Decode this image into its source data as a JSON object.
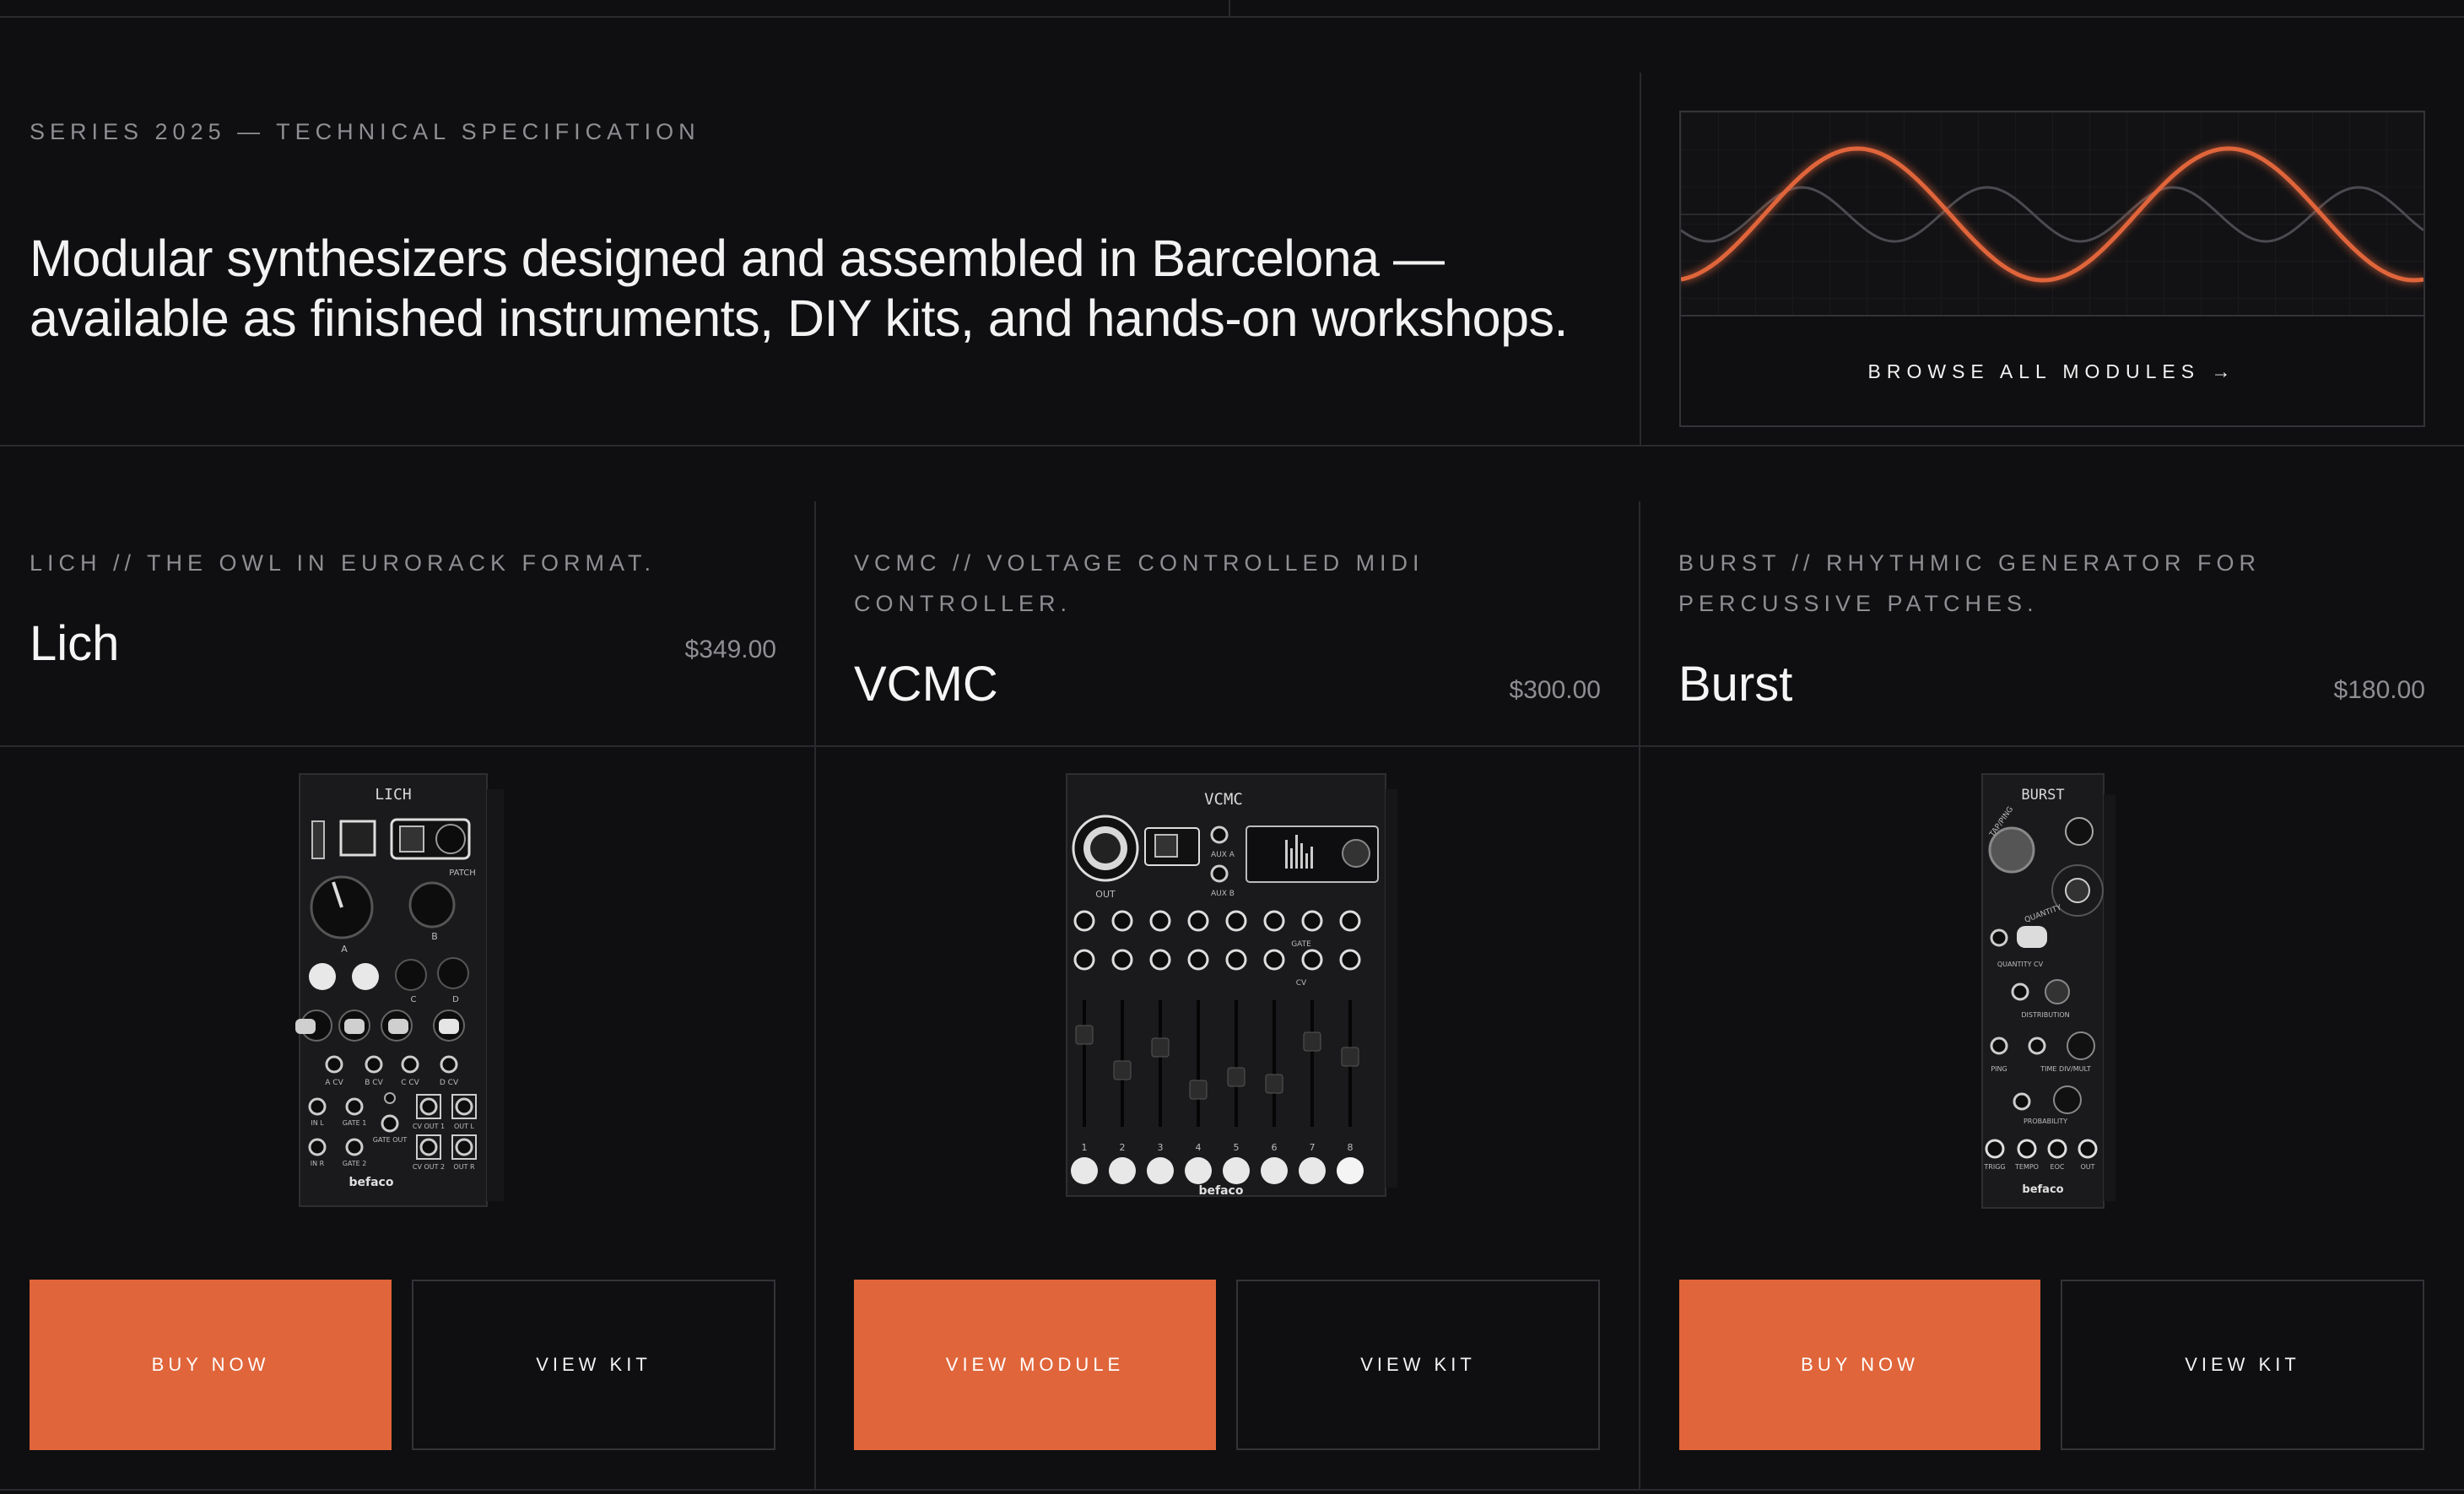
{
  "hero": {
    "eyebrow": "SERIES 2025 — TECHNICAL SPECIFICATION",
    "tagline_line1": "Modular synthesizers designed and assembled in Barcelona —",
    "tagline_line2": "available as finished instruments, DIY kits, and hands-on workshops.",
    "browse_label": "BROWSE ALL MODULES →",
    "accent_color": "#e0653a"
  },
  "products": [
    {
      "subtitle": "LICH // THE OWL IN EURORACK FORMAT.",
      "name": "Lich",
      "price": "$349.00",
      "primary_label": "BUY NOW",
      "secondary_label": "VIEW KIT",
      "panel": {
        "header": "LICH",
        "brand": "befaco",
        "labels": [
          "PATCH",
          "A",
          "B",
          "C",
          "D",
          "A CV",
          "B CV",
          "C CV",
          "D CV",
          "IN L",
          "IN R",
          "GATE 1",
          "GATE 2",
          "GATE OUT",
          "CV OUT 1",
          "CV OUT 2",
          "OUT L",
          "OUT R"
        ]
      }
    },
    {
      "subtitle": "VCMC // VOLTAGE CONTROLLED MIDI CONTROLLER.",
      "name": "VCMC",
      "price": "$300.00",
      "primary_label": "VIEW MODULE",
      "secondary_label": "VIEW KIT",
      "panel": {
        "header": "VCMC",
        "brand": "befaco",
        "labels": [
          "OUT",
          "AUX A",
          "AUX B",
          "GATE",
          "CV",
          "1",
          "2",
          "3",
          "4",
          "5",
          "6",
          "7",
          "8"
        ]
      }
    },
    {
      "subtitle": "BURST // RHYTHMIC GENERATOR FOR PERCUSSIVE PATCHES.",
      "name": "Burst",
      "price": "$180.00",
      "primary_label": "BUY NOW",
      "secondary_label": "VIEW KIT",
      "panel": {
        "header": "BURST",
        "brand": "befaco",
        "labels": [
          "TAP/PING",
          "QUANTITY",
          "QUANTITY CV",
          "DISTRIBUTION",
          "PING",
          "TIME DIV/MULT",
          "PROBABILITY",
          "TRIGG",
          "TEMPO",
          "EOC",
          "OUT"
        ]
      }
    }
  ]
}
